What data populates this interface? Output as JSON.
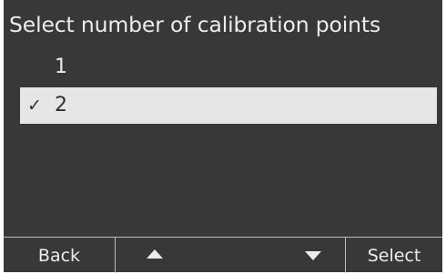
{
  "screen": {
    "title": "Select number of calibration points"
  },
  "options": [
    {
      "label": "1",
      "checked": false,
      "check_mark": ""
    },
    {
      "label": "2",
      "checked": true,
      "check_mark": "✓"
    }
  ],
  "softkeys": {
    "back_label": "Back",
    "up_icon": "triangle-up-icon",
    "down_icon": "triangle-down-icon",
    "select_label": "Select"
  },
  "colors": {
    "background": "#383838",
    "text": "#ececec",
    "highlight": "#e6e6e6",
    "highlight_text": "#303030",
    "divider": "#bdbdbd"
  }
}
